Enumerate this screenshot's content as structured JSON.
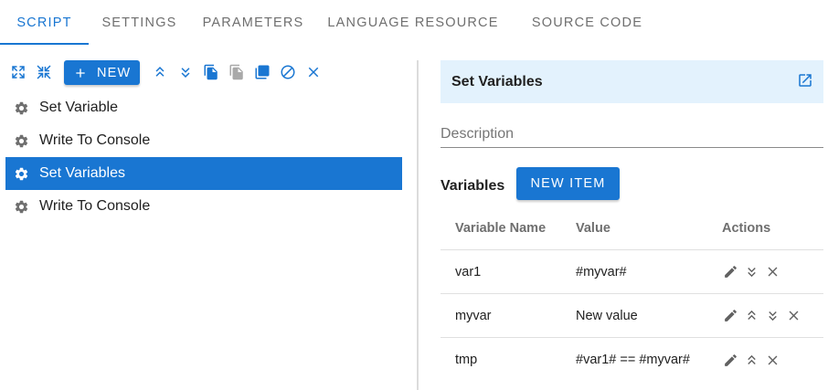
{
  "tabs": [
    {
      "label": "SCRIPT",
      "active": true
    },
    {
      "label": "SETTINGS",
      "active": false
    },
    {
      "label": "PARAMETERS",
      "active": false
    },
    {
      "label": "LANGUAGE RESOURCE",
      "active": false
    },
    {
      "label": "SOURCE CODE",
      "active": false
    }
  ],
  "toolbar": {
    "new_label": "NEW",
    "icons": [
      "expand-icon",
      "collapse-icon",
      "plus-icon",
      "move-up-icon",
      "move-down-icon",
      "copy-icon",
      "paste-icon",
      "duplicate-icon",
      "disable-icon",
      "delete-icon"
    ]
  },
  "tree": {
    "items": [
      {
        "label": "Set Variable",
        "selected": false,
        "icon": "gear-icon"
      },
      {
        "label": "Write To Console",
        "selected": false,
        "icon": "gear-icon"
      },
      {
        "label": "Set Variables",
        "selected": true,
        "icon": "gear-icon"
      },
      {
        "label": "Write To Console",
        "selected": false,
        "icon": "gear-icon"
      }
    ]
  },
  "panel": {
    "title": "Set Variables",
    "description_placeholder": "Description",
    "description_value": "",
    "variables_label": "Variables",
    "new_item_label": "NEW ITEM",
    "table": {
      "headers": [
        "Variable Name",
        "Value",
        "Actions"
      ],
      "rows": [
        {
          "name": "var1",
          "value": "#myvar#",
          "actions": [
            "edit-icon",
            "move-down-icon",
            "delete-icon"
          ]
        },
        {
          "name": "myvar",
          "value": "New value",
          "actions": [
            "edit-icon",
            "move-up-icon",
            "move-down-icon",
            "delete-icon"
          ]
        },
        {
          "name": "tmp",
          "value": "#var1# == #myvar#",
          "actions": [
            "edit-icon",
            "move-up-icon",
            "delete-icon"
          ]
        }
      ]
    }
  },
  "colors": {
    "accent": "#1976d2",
    "header_bg": "#e3f2fd",
    "muted": "#6f6f6f"
  }
}
